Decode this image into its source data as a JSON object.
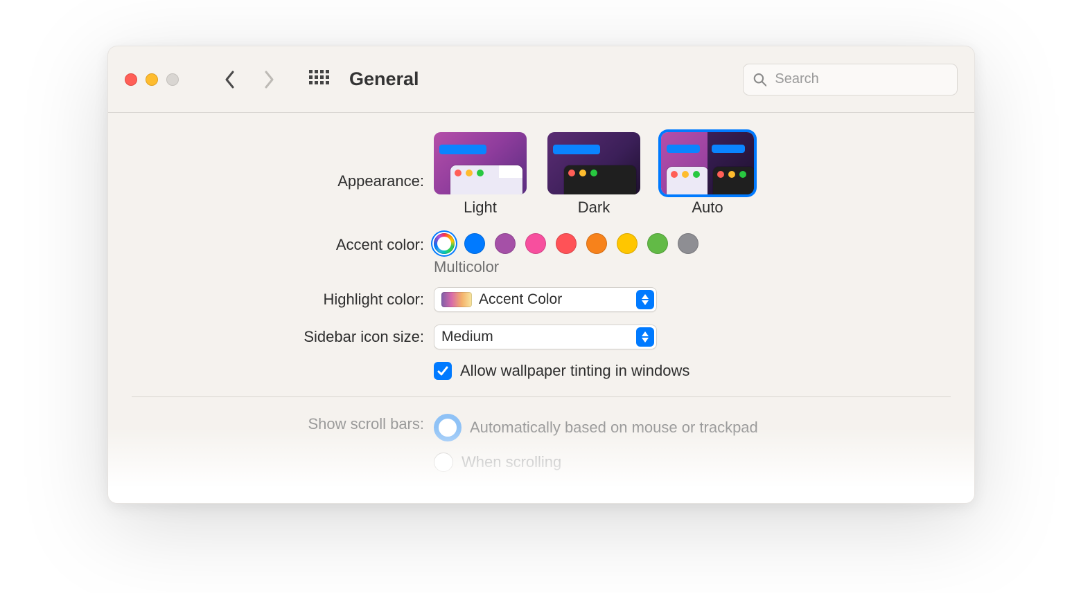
{
  "window": {
    "title": "General"
  },
  "search": {
    "placeholder": "Search"
  },
  "appearance": {
    "label": "Appearance:",
    "options": {
      "light": "Light",
      "dark": "Dark",
      "auto": "Auto"
    },
    "selected": "auto"
  },
  "accent": {
    "label": "Accent color:",
    "caption": "Multicolor",
    "colors": {
      "multicolor": "multicolor",
      "blue": "#007aff",
      "purple": "#a550a7",
      "pink": "#f74f9e",
      "red": "#ff5257",
      "orange": "#f7821b",
      "yellow": "#ffc600",
      "green": "#62ba46",
      "graphite": "#8e8e93"
    },
    "selected": "multicolor"
  },
  "highlight": {
    "label": "Highlight color:",
    "value": "Accent Color"
  },
  "sidebar_icon": {
    "label": "Sidebar icon size:",
    "value": "Medium"
  },
  "wallpaper_tint": {
    "label": "Allow wallpaper tinting in windows",
    "checked": true
  },
  "scrollbars": {
    "label": "Show scroll bars:",
    "options": {
      "auto": "Automatically based on mouse or trackpad",
      "scrolling": "When scrolling"
    },
    "selected": "auto"
  }
}
